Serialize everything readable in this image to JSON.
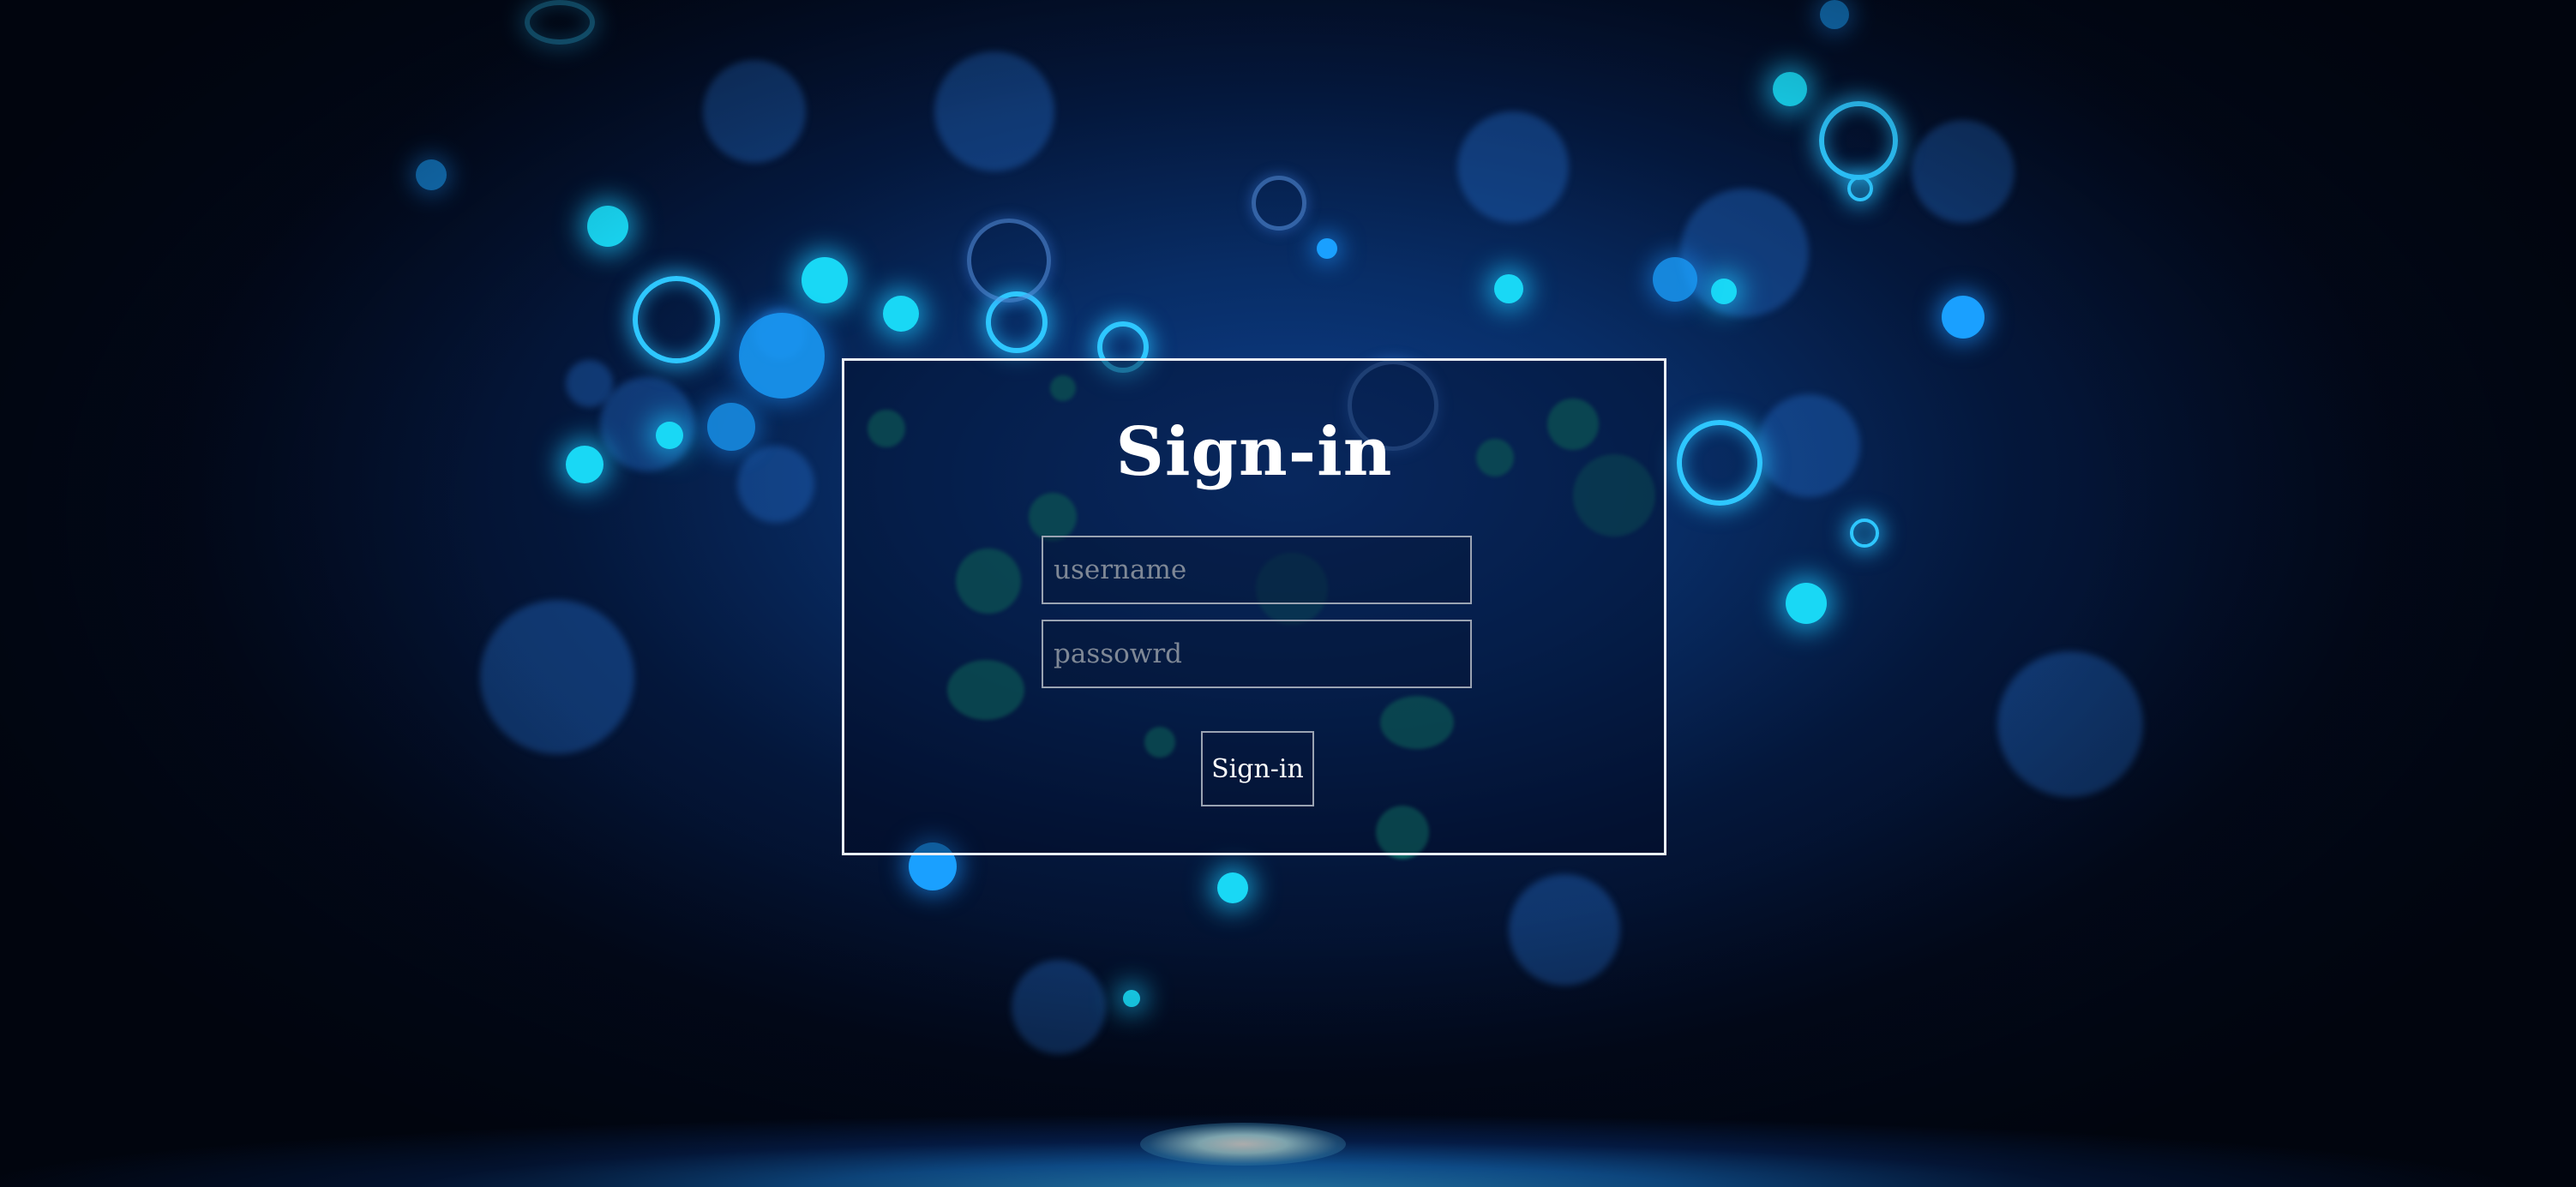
{
  "page": {
    "title": "Sign-in"
  },
  "form": {
    "username_placeholder": "username",
    "password_placeholder": "passowrd",
    "submit_label": "Sign-in"
  },
  "colors": {
    "background": "#04173b",
    "accent": "#19d8f5",
    "panel_border": "#e9eef5",
    "text": "#ffffff"
  }
}
